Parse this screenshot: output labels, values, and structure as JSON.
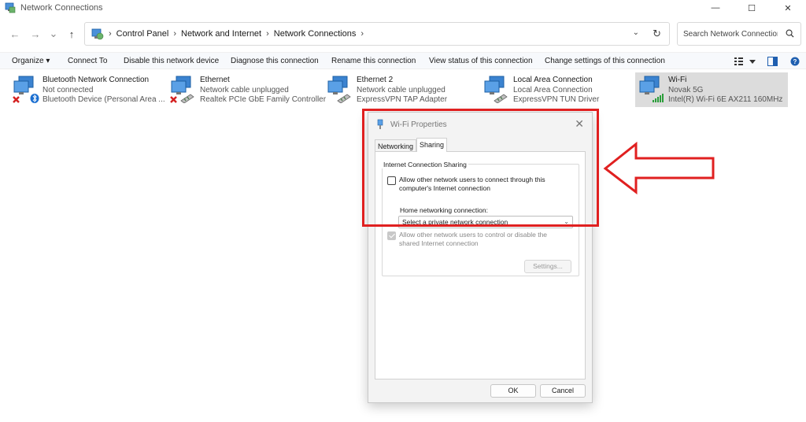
{
  "window": {
    "title": "Network Connections",
    "controls": {
      "minimize": "—",
      "maximize": "☐",
      "close": "✕"
    }
  },
  "nav": {
    "back": "←",
    "forward": "→",
    "recent": "⌄",
    "up": "↑"
  },
  "address": {
    "breadcrumbs": [
      "Control Panel",
      "Network and Internet",
      "Network Connections"
    ],
    "separator": "›",
    "dropdown": "⌄",
    "refresh": "↻"
  },
  "search": {
    "placeholder": "Search Network Connections"
  },
  "commands": {
    "organize": "Organize ▾",
    "connect_to": "Connect To",
    "disable": "Disable this network device",
    "diagnose": "Diagnose this connection",
    "rename": "Rename this connection",
    "view_status": "View status of this connection",
    "change_settings": "Change settings of this connection"
  },
  "connections": [
    {
      "name": "Bluetooth Network Connection",
      "status": "Not connected",
      "device": "Bluetooth Device (Personal Area ...",
      "icon": "bluetooth-network-icon",
      "selected": false
    },
    {
      "name": "Ethernet",
      "status": "Network cable unplugged",
      "device": "Realtek PCIe GbE Family Controller",
      "icon": "ethernet-network-icon",
      "selected": false
    },
    {
      "name": "Ethernet 2",
      "status": "Network cable unplugged",
      "device": "ExpressVPN TAP Adapter",
      "icon": "ethernet-network-icon",
      "selected": false
    },
    {
      "name": "Local Area Connection",
      "status": "Local Area Connection",
      "device": "ExpressVPN TUN Driver",
      "icon": "ethernet-network-icon",
      "selected": false
    },
    {
      "name": "Wi-Fi",
      "status": "Novak 5G",
      "device": "Intel(R) Wi-Fi 6E AX211 160MHz",
      "icon": "wifi-network-icon",
      "selected": true
    }
  ],
  "dialog": {
    "title": "Wi-Fi Properties",
    "close": "✕",
    "tabs": [
      {
        "label": "Networking",
        "active": false
      },
      {
        "label": "Sharing",
        "active": true
      }
    ],
    "group_title": "Internet Connection Sharing",
    "allow_connect": "Allow other network users to connect through this computer's Internet connection",
    "home_label": "Home networking connection:",
    "home_select": "Select a private network connection",
    "allow_control": "Allow other network users to control or disable the shared Internet connection",
    "settings_button": "Settings...",
    "ok_button": "OK",
    "cancel_button": "Cancel"
  },
  "colors": {
    "annotation": "#e02020",
    "selected_bg": "#dcdcdc",
    "dialog_bg": "#f3f3f3"
  }
}
